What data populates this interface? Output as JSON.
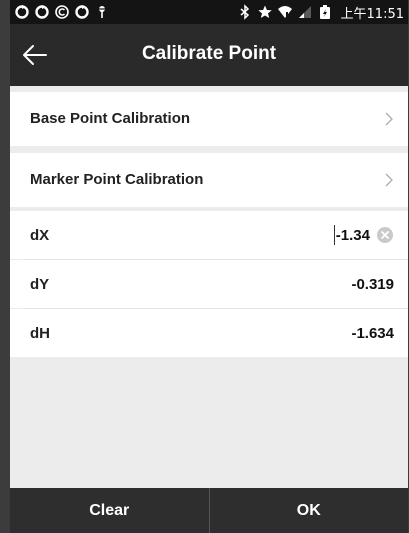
{
  "status_bar": {
    "time": "上午11:51",
    "left_icons": [
      "sync-icon",
      "sync-icon",
      "copyright-icon",
      "sync-icon",
      "location-pin-icon"
    ],
    "right_icons": [
      "bluetooth-icon",
      "star-icon",
      "wifi-icon",
      "signal-icon",
      "battery-icon"
    ]
  },
  "header": {
    "title": "Calibrate Point",
    "back_icon": "arrow-left-icon"
  },
  "menu": {
    "base_point": "Base Point Calibration",
    "marker_point": "Marker Point Calibration"
  },
  "fields": {
    "dx": {
      "label": "dX",
      "value": "-1.34"
    },
    "dy": {
      "label": "dY",
      "value": "-0.319"
    },
    "dh": {
      "label": "dH",
      "value": "-1.634"
    }
  },
  "footer": {
    "clear_label": "Clear",
    "ok_label": "OK"
  },
  "colors": {
    "app_bar": "#2a2a2a",
    "status_bar": "#141414",
    "background": "#ececec",
    "bottom_bar": "#2e2e2e"
  }
}
